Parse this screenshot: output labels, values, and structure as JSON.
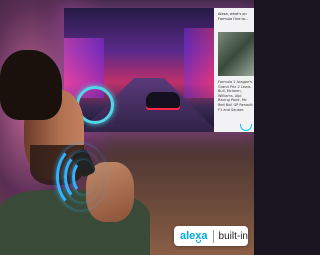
{
  "tv_panel": {
    "heading": "Alexa, what's on Formula One to...",
    "body": "Formula 1 Aragon's Grand Prix 2 Lewis Bull, Mclaren, Williams, Alpi Racing Point, Mc Red Bull GP Renault F1 and Sauber."
  },
  "badge": {
    "brand": "alexa",
    "label": "built-in",
    "brand_color": "#00a8e1"
  },
  "icons": [
    "voice-waves-icon",
    "alexa-ring-icon"
  ]
}
